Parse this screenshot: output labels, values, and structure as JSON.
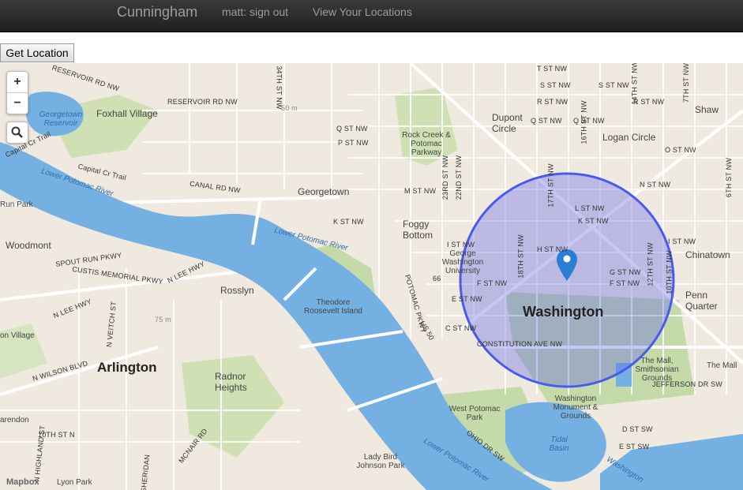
{
  "navbar": {
    "brand": "Cunningham",
    "user_link": "matt: sign out",
    "locations_link": "View Your Locations"
  },
  "actions": {
    "get_location": "Get Location"
  },
  "map": {
    "zoom_in": "+",
    "zoom_out": "−",
    "search_icon": "magnifier-icon",
    "attribution": "Mapbox",
    "accent_circle_color": "#4a5af0",
    "water_color": "#75b0e3",
    "park_color": "#c4dba9",
    "marker_color": "#2a7fd4",
    "labels": {
      "city": "Washington",
      "arlington": "Arlington",
      "georgetown": "Georgetown",
      "foggy_bottom": "Foggy Bottom",
      "dupont": "Dupont Circle",
      "logan": "Logan Circle",
      "shaw": "Shaw",
      "chinatown": "Chinatown",
      "penn": "Penn Quarter",
      "rosslyn": "Rosslyn",
      "foxhall": "Foxhall Village",
      "woodmont": "Woodmont",
      "radnor": "Radnor Heights",
      "mall": "The Mall",
      "mall_grounds": "The Mall, Smithsonian Grounds",
      "gwu": "George Washington University",
      "wpp": "West Potomac Park",
      "monument": "Washington Monument & Grounds",
      "tidal": "Tidal Basin",
      "roosevelt": "Theodore Roosevelt Island",
      "rock_creek": "Rock Creek & Potomac Parkway",
      "lady_bird": "Lady Bird Johnson Park",
      "lyon": "Lyon Park",
      "reservoir": "Georgetown Reservoir",
      "run_park": "Run Park",
      "n_village": "on Village",
      "arendon": "arendon"
    },
    "water_labels": {
      "lower_potomac_1": "Lower Potomac River",
      "lower_potomac_2": "Lower Potomac River",
      "lower_potomac_3": "Lower Potomac River",
      "potomac_br": "Washington"
    },
    "streets": {
      "reservoir_rd_1": "RESERVOIR RD NW",
      "reservoir_rd_2": "RESERVOIR RD NW",
      "canal_rd": "CANAL RD NW",
      "capital_cr": "Capital Cr Trail",
      "capital_cr2": "Capital Cr Trail",
      "spout_run": "SPOUT RUN PKWY",
      "custis": "CUSTIS MEMORIAL PKWY",
      "n_lee": "N LEE HWY",
      "n_lee2": "N LEE HWY",
      "n_veitch": "N VEITCH ST",
      "n_wilson": "N WILSON BLVD",
      "tenth_st_n": "10TH ST N",
      "n_highland": "N HIGHLAND ST",
      "mcnair": "MCNAIR RD",
      "sheridan": "SHERIDAN",
      "thirty_fourth": "34TH ST NW",
      "q_st": "Q ST NW",
      "p_st": "P ST NW",
      "m_st": "M ST NW",
      "k_st": "K ST NW",
      "i_st": "I ST NW",
      "h_st": "H ST NW",
      "f_st": "F ST NW",
      "e_st": "E ST NW",
      "c_st": "C ST NW",
      "l_st": "L ST NW",
      "k_st2": "K ST NW",
      "g_st": "G ST NW",
      "f_st2": "F ST NW",
      "t_st": "T ST NW",
      "s_st": "S ST NW",
      "s_st2": "S ST NW",
      "r_st": "R ST NW",
      "r_st2": "R ST NW",
      "q_st2": "Q ST NW",
      "q_st3": "Q ST NW",
      "o_st": "O ST NW",
      "n_st": "N ST NW",
      "i_st2": "I ST NW",
      "constitution": "CONSTITUTION AVE NW",
      "jefferson": "JEFFERSON DR SW",
      "ohio": "OHIO DR SW",
      "d_st_sw": "D ST SW",
      "e_st_sw": "E ST SW",
      "potomac_pkwy": "POTOMAC PKWY",
      "us50": "US 50",
      "twentythird": "23RD ST NW",
      "twentysecond": "22ND ST NW",
      "eighteenth": "18TH ST NW",
      "seventeenth": "17TH ST NW",
      "sixteenth": "16TH ST NW",
      "fourteenth": "14TH ST NW",
      "twelfth": "12TH ST NW",
      "tenth": "10TH ST NW",
      "sixth": "6TH ST NW",
      "seventh": "7TH ST NW",
      "one_sixty_six": "66",
      "fifty_m": "50 m",
      "seventy_five_m": "75 m"
    }
  }
}
